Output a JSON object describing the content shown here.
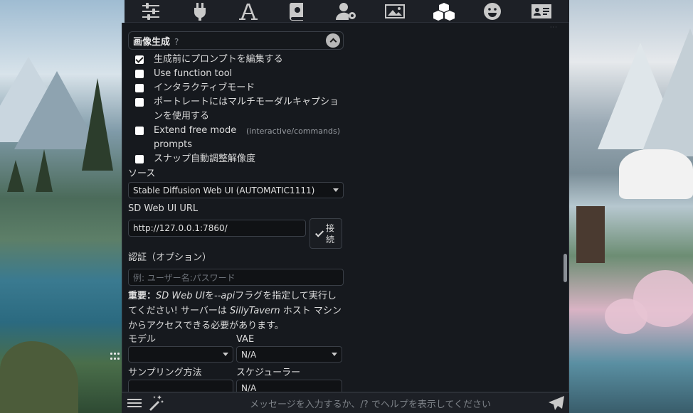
{
  "toolbar": {
    "icons": [
      "sliders-icon",
      "plug-icon",
      "font-icon",
      "book-icon",
      "user-cog-icon",
      "image-icon",
      "cubes-icon",
      "smile-icon",
      "id-card-icon"
    ]
  },
  "section": {
    "title": "画像生成",
    "help": "?"
  },
  "checkboxes": [
    {
      "label": "生成前にプロンプトを編集する",
      "checked": true
    },
    {
      "label": "Use function tool",
      "checked": false
    },
    {
      "label": "インタラクティブモード",
      "checked": false
    },
    {
      "label": "ポートレートにはマルチモーダルキャプションを使用する",
      "checked": false
    },
    {
      "label": "Extend free mode prompts",
      "hint": "(interactive/commands)",
      "checked": false
    },
    {
      "label": "スナップ自動調整解像度",
      "checked": false
    }
  ],
  "source": {
    "label": "ソース",
    "value": "Stable Diffusion Web UI (AUTOMATIC1111)"
  },
  "url": {
    "label": "SD Web UI URL",
    "value": "http://127.0.0.1:7860/",
    "connect_line1": "接",
    "connect_line2": "続"
  },
  "auth": {
    "label": "認証（オプション）",
    "placeholder": "例: ユーザー名:パスワード"
  },
  "note": {
    "bold": "重要：",
    "italic1": "SD Web UI",
    "t1": "を",
    "code": "--api",
    "t2": "フラグを指定して実行してください! サーバーは ",
    "italic2": "SillyTavern",
    "t3": " ホスト マシンからアクセスできる必要があります。"
  },
  "model": {
    "label": "モデル",
    "value": ""
  },
  "vae": {
    "label": "VAE",
    "value": "N/A"
  },
  "sampler": {
    "label": "サンプリング方法"
  },
  "scheduler": {
    "label": "スケジューラー",
    "value": "N/A"
  },
  "chat": {
    "placeholder": "メッセージを入力するか、/? でヘルプを表示してください"
  }
}
